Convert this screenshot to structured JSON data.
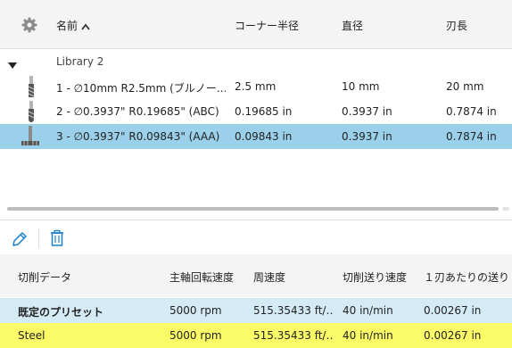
{
  "tool_table": {
    "columns": {
      "name": "名前",
      "corner_radius": "コーナー半径",
      "diameter": "直径",
      "flute_length": "刃長"
    },
    "group_label": "Library 2",
    "rows": [
      {
        "name": "1 - ∅10mm R2.5mm (ブルノー…",
        "corner_radius": "2.5 mm",
        "diameter": "10 mm",
        "flute_length": "20 mm"
      },
      {
        "name": "2 - ∅0.3937\" R0.19685\" (ABC)",
        "corner_radius": "0.19685 in",
        "diameter": "0.3937 in",
        "flute_length": "0.7874 in"
      },
      {
        "name": "3 - ∅0.3937\" R0.09843\" (AAA)",
        "corner_radius": "0.09843 in",
        "diameter": "0.3937 in",
        "flute_length": "0.7874 in"
      }
    ],
    "selected_row": 2
  },
  "presets_table": {
    "columns": {
      "cutting_data": "切削データ",
      "spindle_speed": "主軸回転速度",
      "surface_speed": "周速度",
      "feedrate": "切削送り速度",
      "feed_per_tooth": "１刃あたりの送り"
    },
    "rows": [
      {
        "cutting_data": "既定のプリセット",
        "spindle_speed": "5000 rpm",
        "surface_speed": "515.35433 ft/…",
        "feedrate": "40 in/min",
        "feed_per_tooth": "0.00267 in"
      },
      {
        "cutting_data": "Steel",
        "spindle_speed": "5000 rpm",
        "surface_speed": "515.35433 ft/…",
        "feedrate": "40 in/min",
        "feed_per_tooth": "0.00267 in"
      }
    ]
  },
  "colors": {
    "selected_row": "#9ad0ea",
    "preset_row": "#d4ebf6",
    "steel_row": "#fbfb67",
    "accent_icon": "#1a7fc9"
  },
  "icons": {
    "settings": "gear-icon",
    "sort": "sort-ascending-icon",
    "expand": "triangle-down-icon",
    "edit": "pencil-icon",
    "delete": "trash-icon"
  }
}
